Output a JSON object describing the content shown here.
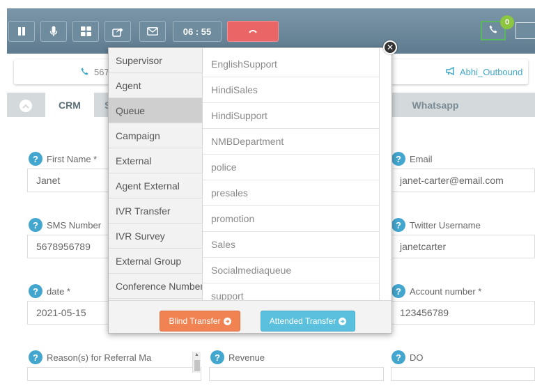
{
  "toolbar": {
    "timer": "06 : 55",
    "call_badge": "0"
  },
  "info_strip": {
    "phone": "567",
    "campaign": "Abhi_Outbound"
  },
  "tabs": {
    "crm": "CRM",
    "second": "S",
    "whatsapp": "Whatsapp"
  },
  "form": {
    "first_name": {
      "label": "First Name *",
      "value": "Janet"
    },
    "email": {
      "label": "Email",
      "value": "janet-carter@email.com"
    },
    "sms_number": {
      "label": "SMS Number",
      "value": "5678956789"
    },
    "twitter": {
      "label": "Twitter Username",
      "value": "janetcarter"
    },
    "date": {
      "label": "date *",
      "value": "2021-05-15"
    },
    "account_number": {
      "label": "Account number *",
      "value": "123456789"
    },
    "referral": {
      "label": "Reason(s) for Referral Ma"
    },
    "revenue": {
      "label": "Revenue"
    },
    "do": {
      "label": "DO"
    }
  },
  "transfer": {
    "categories": [
      "Supervisor",
      "Agent",
      "Queue",
      "Campaign",
      "External",
      "Agent External",
      "IVR Transfer",
      "IVR Survey",
      "External Group",
      "Conference Number"
    ],
    "selected_category": "Queue",
    "queues": [
      "EnglishSupport",
      "HindiSales",
      "HindiSupport",
      "NMBDepartment",
      "police",
      "presales",
      "promotion",
      "Sales",
      "Socialmediaqueue",
      "support"
    ],
    "blind_label": "Blind Transfer",
    "attended_label": "Attended Transfer",
    "close_glyph": "✕"
  },
  "colors": {
    "toolbar": "#6f8b9e",
    "hangup": "#ea6565",
    "blind_button": "#f18352",
    "attended_button": "#5bc0de",
    "help_icon": "#43a6cf",
    "call_badge": "#8cc63f"
  }
}
